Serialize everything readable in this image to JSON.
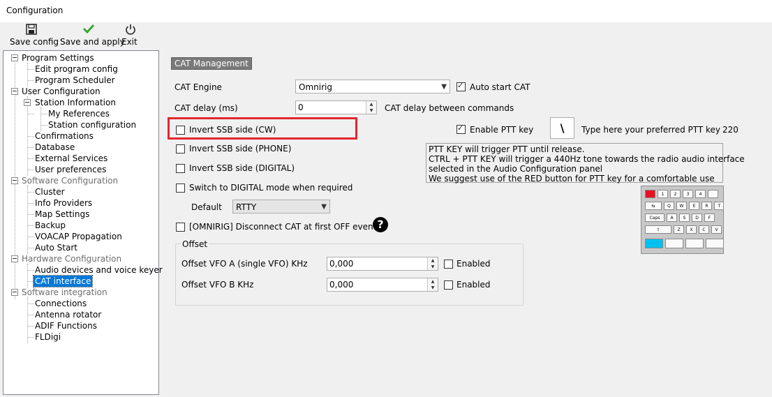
{
  "window": {
    "title": "Configuration"
  },
  "toolbar": {
    "save_config": "Save config",
    "save_and_apply": "Save and apply",
    "exit": "Exit"
  },
  "tree": {
    "program_settings": "Program Settings",
    "edit_program_config": "Edit program config",
    "program_scheduler": "Program Scheduler",
    "user_configuration": "User Configuration",
    "station_information": "Station Information",
    "my_references": "My References",
    "station_configuration": "Station configuration",
    "confirmations": "Confirmations",
    "database": "Database",
    "external_services": "External Services",
    "user_preferences": "User preferences",
    "software_configuration": "Software Configuration",
    "cluster": "Cluster",
    "info_providers": "Info Providers",
    "map_settings": "Map Settings",
    "backup": "Backup",
    "voacap_propagation": "VOACAP Propagation",
    "auto_start": "Auto Start",
    "hardware_configuration": "Hardware Configuration",
    "audio_devices": "Audio devices and voice keyer",
    "cat_interface": "CAT interface",
    "software_integration": "Software integration",
    "connections": "Connections",
    "antenna_rotator": "Antenna rotator",
    "adif_functions": "ADIF Functions",
    "fldigi": "FLDigi"
  },
  "cat": {
    "section_title": "CAT Management",
    "engine_label": "CAT Engine",
    "engine_value": "Omnirig",
    "auto_start_label": "Auto start CAT",
    "auto_start_checked": true,
    "delay_label": "CAT delay (ms)",
    "delay_value": "0",
    "delay_hint": "CAT delay between commands",
    "invert_cw_label": "Invert SSB side (CW)",
    "invert_phone_label": "Invert SSB side (PHONE)",
    "invert_digital_label": "Invert SSB side (DIGITAL)",
    "switch_digital_label": "Switch to DIGITAL mode when required",
    "default_label": "Default",
    "default_value": "RTTY",
    "omnirig_disconnect_label": "[OMNIRIG] Disconnect CAT at first OFF event",
    "enable_ptt_label": "Enable PTT key",
    "enable_ptt_checked": true,
    "ptt_key_value": "\\",
    "ptt_hint": "Type here your preferred PTT key",
    "ptt_code": "220",
    "ptt_info": [
      "PTT KEY will trigger PTT until release.",
      "CTRL + PTT KEY will trigger a 440Hz tone towards the radio audio interface",
      "selected in the Audio Configuration panel",
      "We suggest use of the RED button for PTT key for a comfortable use"
    ]
  },
  "offset": {
    "group_label": "Offset",
    "vfo_a_label": "Offset VFO A (single VFO) KHz",
    "vfo_a_value": "0,000",
    "vfo_a_enabled_label": "Enabled",
    "vfo_b_label": "Offset VFO B KHz",
    "vfo_b_value": "0,000",
    "vfo_b_enabled_label": "Enabled"
  },
  "keyboard": {
    "row1": [
      "",
      "1",
      "2",
      "3",
      "4"
    ],
    "row2": [
      "⇆",
      "Q",
      "W",
      "E",
      "R",
      "T"
    ],
    "row3": [
      "Caps",
      "A",
      "S",
      "D",
      "F"
    ],
    "row4": [
      "⇧",
      "Z",
      "X",
      "C",
      "V"
    ]
  },
  "colors": {
    "highlight": "#e3262f",
    "selection": "#0078d7",
    "ptt_key": "#e81123"
  }
}
